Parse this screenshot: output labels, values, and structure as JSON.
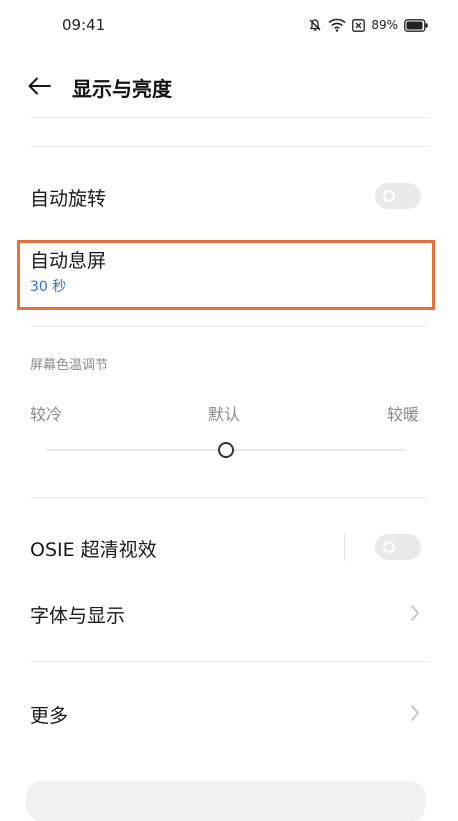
{
  "status_bar": {
    "time": "09:41",
    "battery": "89%",
    "icons": [
      "bell-mute-icon",
      "wifi-icon",
      "close-box-icon",
      "battery-icon"
    ]
  },
  "header": {
    "title": "显示与亮度",
    "back_icon": "back-arrow-icon"
  },
  "settings": {
    "auto_rotate": {
      "label": "自动旋转",
      "enabled": false
    },
    "auto_screen_off": {
      "label": "自动息屏",
      "value": "30 秒"
    },
    "color_temp": {
      "section_title": "屏幕色温调节",
      "left_label": "较冷",
      "center_label": "默认",
      "right_label": "较暖",
      "level_percent": 50
    },
    "osie": {
      "label": "OSIE 超清视效",
      "enabled": false
    },
    "font_display": {
      "label": "字体与显示"
    },
    "more": {
      "label": "更多"
    }
  },
  "colors": {
    "accent_blue": "#2f6fd6",
    "highlight": "#e8703a",
    "toggle_off": "#e9e9e9"
  }
}
